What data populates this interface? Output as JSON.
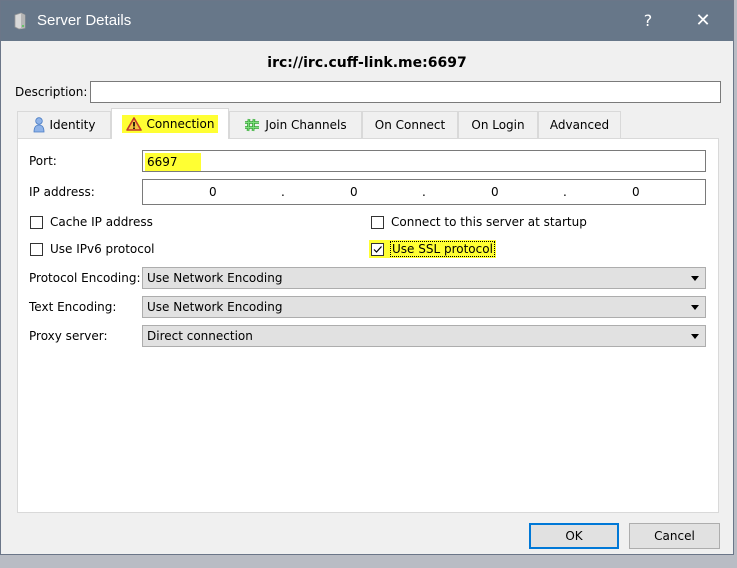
{
  "window": {
    "title": "Server Details",
    "app_icon": "server-icon",
    "help_label": "?",
    "close_label": "✕"
  },
  "server_url": "irc://irc.cuff-link.me:6697",
  "description": {
    "label": "Description:",
    "value": ""
  },
  "tabs": [
    {
      "label": "Identity",
      "icon": "user-icon",
      "active": false
    },
    {
      "label": "Connection",
      "icon": "warning-icon",
      "active": true
    },
    {
      "label": "Join Channels",
      "icon": "hash-icon",
      "active": false
    },
    {
      "label": "On Connect",
      "active": false
    },
    {
      "label": "On Login",
      "active": false
    },
    {
      "label": "Advanced",
      "active": false
    }
  ],
  "connection": {
    "port": {
      "label": "Port:",
      "value": "6697"
    },
    "ip": {
      "label": "IP address:",
      "octets": [
        "0",
        "0",
        "0",
        "0"
      ],
      "separator": "."
    },
    "checkboxes": {
      "cache_ip": {
        "label": "Cache IP address",
        "checked": false
      },
      "use_ipv6": {
        "label": "Use IPv6 protocol",
        "checked": false
      },
      "connect_startup": {
        "label": "Connect to this server at startup",
        "checked": false
      },
      "use_ssl": {
        "label": "Use SSL protocol",
        "checked": true
      }
    },
    "protocol_encoding": {
      "label": "Protocol Encoding:",
      "value": "Use Network Encoding"
    },
    "text_encoding": {
      "label": "Text Encoding:",
      "value": "Use Network Encoding"
    },
    "proxy_server": {
      "label": "Proxy server:",
      "value": "Direct connection"
    }
  },
  "buttons": {
    "ok": "OK",
    "cancel": "Cancel"
  },
  "colors": {
    "titlebar": "#677789",
    "highlight": "#ffff33",
    "default_button_border": "#0078d7"
  }
}
